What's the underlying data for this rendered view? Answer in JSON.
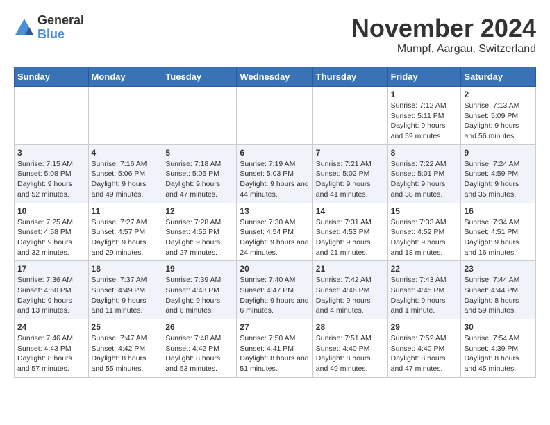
{
  "logo": {
    "general": "General",
    "blue": "Blue"
  },
  "title": "November 2024",
  "location": "Mumpf, Aargau, Switzerland",
  "weekdays": [
    "Sunday",
    "Monday",
    "Tuesday",
    "Wednesday",
    "Thursday",
    "Friday",
    "Saturday"
  ],
  "weeks": [
    [
      {
        "day": "",
        "info": ""
      },
      {
        "day": "",
        "info": ""
      },
      {
        "day": "",
        "info": ""
      },
      {
        "day": "",
        "info": ""
      },
      {
        "day": "",
        "info": ""
      },
      {
        "day": "1",
        "info": "Sunrise: 7:12 AM\nSunset: 5:11 PM\nDaylight: 9 hours and 59 minutes."
      },
      {
        "day": "2",
        "info": "Sunrise: 7:13 AM\nSunset: 5:09 PM\nDaylight: 9 hours and 56 minutes."
      }
    ],
    [
      {
        "day": "3",
        "info": "Sunrise: 7:15 AM\nSunset: 5:08 PM\nDaylight: 9 hours and 52 minutes."
      },
      {
        "day": "4",
        "info": "Sunrise: 7:16 AM\nSunset: 5:06 PM\nDaylight: 9 hours and 49 minutes."
      },
      {
        "day": "5",
        "info": "Sunrise: 7:18 AM\nSunset: 5:05 PM\nDaylight: 9 hours and 47 minutes."
      },
      {
        "day": "6",
        "info": "Sunrise: 7:19 AM\nSunset: 5:03 PM\nDaylight: 9 hours and 44 minutes."
      },
      {
        "day": "7",
        "info": "Sunrise: 7:21 AM\nSunset: 5:02 PM\nDaylight: 9 hours and 41 minutes."
      },
      {
        "day": "8",
        "info": "Sunrise: 7:22 AM\nSunset: 5:01 PM\nDaylight: 9 hours and 38 minutes."
      },
      {
        "day": "9",
        "info": "Sunrise: 7:24 AM\nSunset: 4:59 PM\nDaylight: 9 hours and 35 minutes."
      }
    ],
    [
      {
        "day": "10",
        "info": "Sunrise: 7:25 AM\nSunset: 4:58 PM\nDaylight: 9 hours and 32 minutes."
      },
      {
        "day": "11",
        "info": "Sunrise: 7:27 AM\nSunset: 4:57 PM\nDaylight: 9 hours and 29 minutes."
      },
      {
        "day": "12",
        "info": "Sunrise: 7:28 AM\nSunset: 4:55 PM\nDaylight: 9 hours and 27 minutes."
      },
      {
        "day": "13",
        "info": "Sunrise: 7:30 AM\nSunset: 4:54 PM\nDaylight: 9 hours and 24 minutes."
      },
      {
        "day": "14",
        "info": "Sunrise: 7:31 AM\nSunset: 4:53 PM\nDaylight: 9 hours and 21 minutes."
      },
      {
        "day": "15",
        "info": "Sunrise: 7:33 AM\nSunset: 4:52 PM\nDaylight: 9 hours and 18 minutes."
      },
      {
        "day": "16",
        "info": "Sunrise: 7:34 AM\nSunset: 4:51 PM\nDaylight: 9 hours and 16 minutes."
      }
    ],
    [
      {
        "day": "17",
        "info": "Sunrise: 7:36 AM\nSunset: 4:50 PM\nDaylight: 9 hours and 13 minutes."
      },
      {
        "day": "18",
        "info": "Sunrise: 7:37 AM\nSunset: 4:49 PM\nDaylight: 9 hours and 11 minutes."
      },
      {
        "day": "19",
        "info": "Sunrise: 7:39 AM\nSunset: 4:48 PM\nDaylight: 9 hours and 8 minutes."
      },
      {
        "day": "20",
        "info": "Sunrise: 7:40 AM\nSunset: 4:47 PM\nDaylight: 9 hours and 6 minutes."
      },
      {
        "day": "21",
        "info": "Sunrise: 7:42 AM\nSunset: 4:46 PM\nDaylight: 9 hours and 4 minutes."
      },
      {
        "day": "22",
        "info": "Sunrise: 7:43 AM\nSunset: 4:45 PM\nDaylight: 9 hours and 1 minute."
      },
      {
        "day": "23",
        "info": "Sunrise: 7:44 AM\nSunset: 4:44 PM\nDaylight: 8 hours and 59 minutes."
      }
    ],
    [
      {
        "day": "24",
        "info": "Sunrise: 7:46 AM\nSunset: 4:43 PM\nDaylight: 8 hours and 57 minutes."
      },
      {
        "day": "25",
        "info": "Sunrise: 7:47 AM\nSunset: 4:42 PM\nDaylight: 8 hours and 55 minutes."
      },
      {
        "day": "26",
        "info": "Sunrise: 7:48 AM\nSunset: 4:42 PM\nDaylight: 8 hours and 53 minutes."
      },
      {
        "day": "27",
        "info": "Sunrise: 7:50 AM\nSunset: 4:41 PM\nDaylight: 8 hours and 51 minutes."
      },
      {
        "day": "28",
        "info": "Sunrise: 7:51 AM\nSunset: 4:40 PM\nDaylight: 8 hours and 49 minutes."
      },
      {
        "day": "29",
        "info": "Sunrise: 7:52 AM\nSunset: 4:40 PM\nDaylight: 8 hours and 47 minutes."
      },
      {
        "day": "30",
        "info": "Sunrise: 7:54 AM\nSunset: 4:39 PM\nDaylight: 8 hours and 45 minutes."
      }
    ]
  ]
}
